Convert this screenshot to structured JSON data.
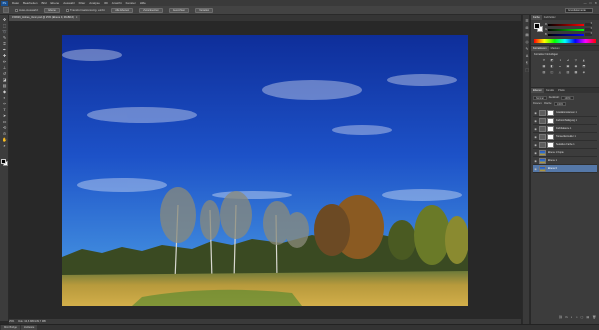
{
  "menubar": {
    "logo": "Ps",
    "items": [
      "Datei",
      "Bearbeiten",
      "Bild",
      "Ebene",
      "Auswahl",
      "Filter",
      "Analyse",
      "3D",
      "Ansicht",
      "Fenster",
      "Hilfe"
    ],
    "window_controls": [
      "—",
      "□",
      "✕"
    ]
  },
  "optionsbar": {
    "checks": [
      "Auto-Auswahl:",
      "Transformationsstrg. einbl."
    ],
    "buttons": [
      "Ebene",
      "Alle Ebenen",
      "Zurücksetzen",
      "Ausrichten",
      "Verteilen"
    ],
    "workspace": "Grundelemente"
  },
  "document": {
    "tab_title": "150626_Hohes_Venn.psd @ 25% (Ebene 0, RGB/16)",
    "tab_close": "×"
  },
  "statusbar": {
    "zoom": "25%",
    "doc_info": "Dok: 34,6 MB/139,7 MB"
  },
  "minibridge": {
    "tabs": [
      "Mini Bridge",
      "Zeitleiste"
    ]
  },
  "toolbox": {
    "tools": [
      {
        "name": "move-tool-icon",
        "glyph": "✥"
      },
      {
        "name": "marquee-tool-icon",
        "glyph": "⬚"
      },
      {
        "name": "lasso-tool-icon",
        "glyph": "➰"
      },
      {
        "name": "quick-select-tool-icon",
        "glyph": "✎"
      },
      {
        "name": "crop-tool-icon",
        "glyph": "⌗"
      },
      {
        "name": "eyedropper-tool-icon",
        "glyph": "✒"
      },
      {
        "name": "healing-brush-tool-icon",
        "glyph": "✚"
      },
      {
        "name": "brush-tool-icon",
        "glyph": "✏"
      },
      {
        "name": "clone-stamp-tool-icon",
        "glyph": "⊥"
      },
      {
        "name": "history-brush-tool-icon",
        "glyph": "↺"
      },
      {
        "name": "eraser-tool-icon",
        "glyph": "◪"
      },
      {
        "name": "gradient-tool-icon",
        "glyph": "▤"
      },
      {
        "name": "blur-tool-icon",
        "glyph": "◆"
      },
      {
        "name": "dodge-tool-icon",
        "glyph": "◐"
      },
      {
        "name": "pen-tool-icon",
        "glyph": "✑"
      },
      {
        "name": "type-tool-icon",
        "glyph": "T"
      },
      {
        "name": "path-select-tool-icon",
        "glyph": "➤"
      },
      {
        "name": "shape-tool-icon",
        "glyph": "▭"
      },
      {
        "name": "3d-rotate-tool-icon",
        "glyph": "⟲"
      },
      {
        "name": "3d-camera-tool-icon",
        "glyph": "⊙"
      },
      {
        "name": "hand-tool-icon",
        "glyph": "✋"
      },
      {
        "name": "zoom-tool-icon",
        "glyph": "⌕"
      }
    ]
  },
  "panels": {
    "color": {
      "tabs": [
        "Farbe",
        "Farbfelder"
      ],
      "sliders": [
        {
          "label": "R",
          "value": "0"
        },
        {
          "label": "G",
          "value": "0"
        },
        {
          "label": "B",
          "value": "0"
        }
      ]
    },
    "adjustments": {
      "tabs": [
        "Korrekturen",
        "Masken"
      ],
      "title": "Korrektur hinzufügen",
      "icons": [
        "☀",
        "◩",
        "◑",
        "⊿",
        "▽",
        "◭",
        "▦",
        "◧",
        "◒",
        "▣",
        "◉",
        "⬒",
        "▨",
        "◫",
        "◬",
        "▥",
        "▩",
        "◈"
      ]
    },
    "layers": {
      "tabs": [
        "Ebenen",
        "Kanäle",
        "Pfade"
      ],
      "kind": "Normal",
      "opacity_label": "Deckkraft:",
      "opacity": "100%",
      "lock_label": "Fixieren:",
      "fill_label": "Fläche:",
      "fill": "100%",
      "rows": [
        {
          "name": "Gradationskurven 1",
          "type": "adjustment",
          "selected": false
        },
        {
          "name": "Farbton/Sättigung 1",
          "type": "adjustment",
          "selected": false
        },
        {
          "name": "Farbbalance 1",
          "type": "adjustment",
          "selected": false
        },
        {
          "name": "Tonwertkorrektur 1",
          "type": "adjustment",
          "selected": false
        },
        {
          "name": "Selektive Farbe 1",
          "type": "adjustment",
          "selected": false
        },
        {
          "name": "Ebene 1 Kopie",
          "type": "pixel",
          "selected": false
        },
        {
          "name": "Ebene 1",
          "type": "pixel",
          "selected": false
        },
        {
          "name": "Ebene 0",
          "type": "pixel",
          "selected": true
        }
      ],
      "footer_icons": [
        "⛓",
        "fx",
        "◐",
        "◑",
        "▢",
        "▤",
        "🗑"
      ]
    }
  },
  "right_strip": {
    "icons": [
      "☰",
      "⊞",
      "▤",
      "◎",
      "✎",
      "A",
      "¶",
      "⬚"
    ]
  }
}
